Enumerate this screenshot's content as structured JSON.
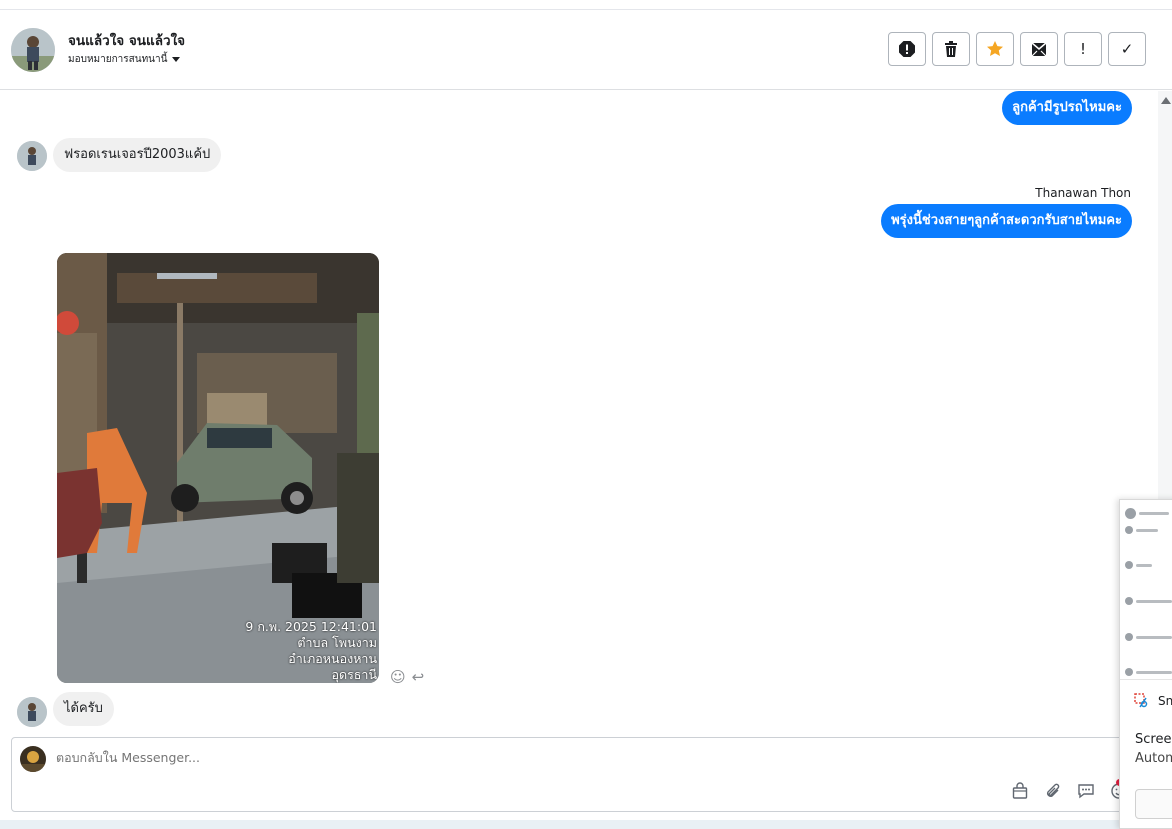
{
  "header": {
    "name": "จนแล้วใจ จนแล้วใจ",
    "assign_label": "มอบหมายการสนทนานี้",
    "tools": [
      {
        "name": "report-icon",
        "title": "report"
      },
      {
        "name": "trash-icon",
        "title": "delete"
      },
      {
        "name": "star-icon",
        "title": "star",
        "color": "#f5a623"
      },
      {
        "name": "mark-unread-icon",
        "title": "mark unread"
      },
      {
        "name": "exclamation-icon",
        "title": "important",
        "glyph": "!"
      },
      {
        "name": "checkmark-icon",
        "title": "done",
        "glyph": "✓"
      }
    ]
  },
  "messages": {
    "out1": "ลูกค้ามีรูปรถไหมคะ",
    "in1": "ฟรอดเรนเจอรปี2003แค้ป",
    "sender": "Thanawan Thon",
    "out2": "พรุ่งนี้ช่วงสายๆลูกค้าสะดวกรับสายไหมคะ",
    "photo_stamp": {
      "datetime": "9 ก.พ. 2025 12:41:01",
      "line2": "ตำบล โพนงาม",
      "line3": "อำเภอหนองหาน",
      "line4": "อุดรธานี"
    },
    "in2": "ได้ครับ"
  },
  "composer": {
    "placeholder": "ตอบกลับใน Messenger..."
  },
  "popup": {
    "app": "Sn",
    "line1": "Screen",
    "line2": "Autom"
  },
  "colors": {
    "accent": "#0a7cff",
    "incoming": "#f0f0f0",
    "star": "#f5a623"
  }
}
